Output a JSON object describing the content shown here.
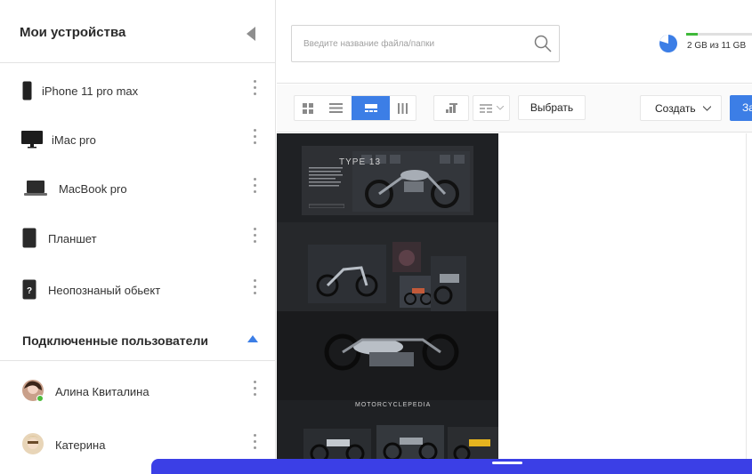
{
  "sidebar": {
    "title": "Мои устройства",
    "devices": [
      {
        "label": "iPhone 11 pro max",
        "icon": "phone-icon"
      },
      {
        "label": "iMac pro",
        "icon": "monitor-icon"
      },
      {
        "label": "MacBook pro",
        "icon": "laptop-icon"
      },
      {
        "label": "Планшет",
        "icon": "tablet-icon"
      },
      {
        "label": "Неопознаный обьект",
        "icon": "unknown-device-icon"
      }
    ],
    "users_title": "Подключенные пользователи",
    "users": [
      {
        "name": "Алина Квиталина",
        "online": true
      },
      {
        "name": "Катерина",
        "online": false
      }
    ]
  },
  "search": {
    "placeholder": "Введите название файла/папки"
  },
  "storage": {
    "used": "2 GB",
    "total": "11 GB",
    "text": "2 GB из 11 GB",
    "fraction": 0.18
  },
  "toolbar": {
    "select_label": "Выбрать",
    "create_label": "Создать",
    "primary_label": "За"
  },
  "preview": {
    "title": "TYPE 13",
    "caption": "MOTORCYCLEPEDIA"
  },
  "colors": {
    "accent": "#3c7ee6",
    "bottom_bar": "#3b3fe6",
    "online": "#4cbb3a",
    "quota": "#3fb93a"
  }
}
